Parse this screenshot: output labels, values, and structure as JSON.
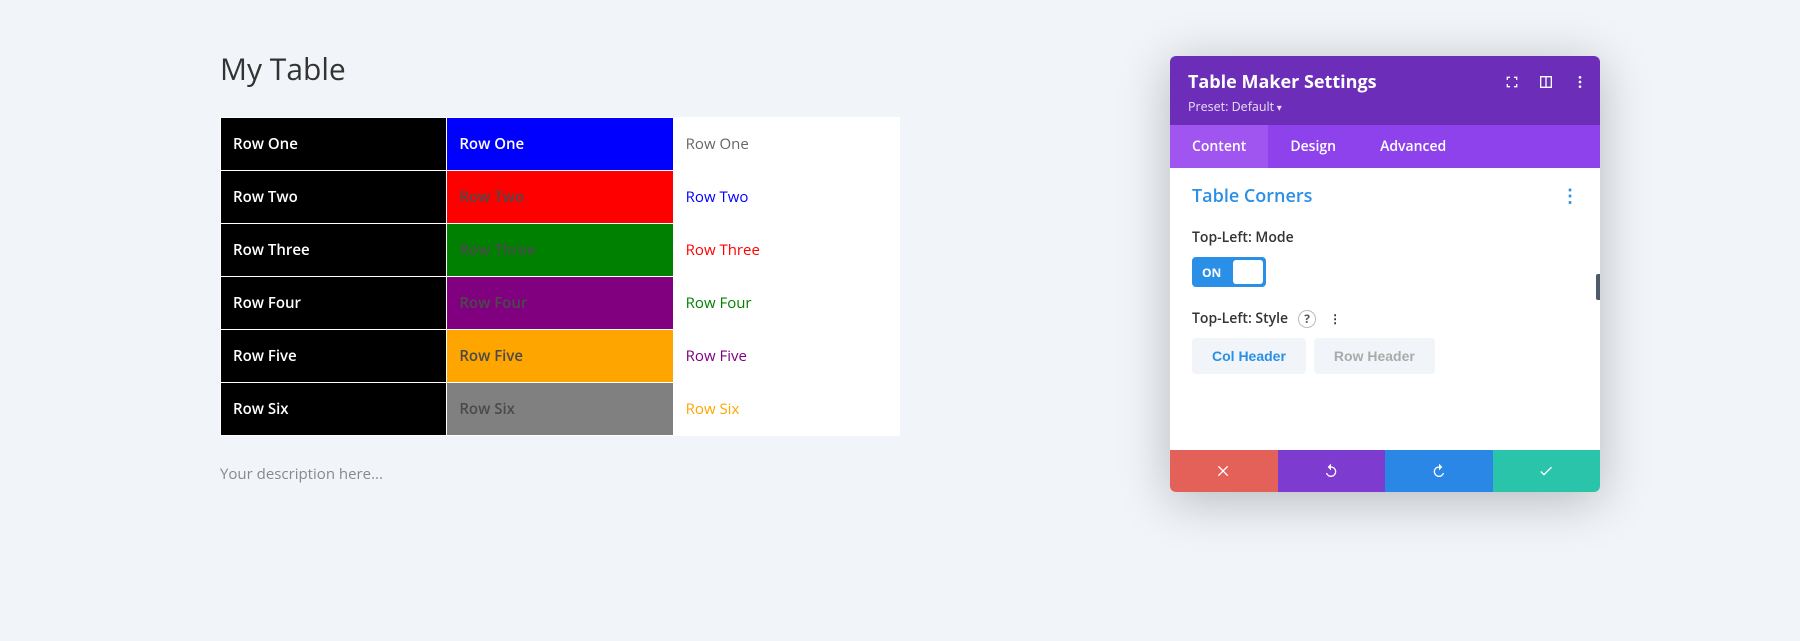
{
  "table": {
    "title": "My Table",
    "description": "Your description here...",
    "rows": [
      {
        "label": "Row One",
        "col2_bg": "#0000ff",
        "col2_fg": "#ffffff",
        "col3_fg": "#666666"
      },
      {
        "label": "Row Two",
        "col2_bg": "#ff0000",
        "col2_fg": "#4a4a4a",
        "col3_fg": "#0000ff"
      },
      {
        "label": "Row Three",
        "col2_bg": "#008000",
        "col2_fg": "#4a4a4a",
        "col3_fg": "#ff0000"
      },
      {
        "label": "Row Four",
        "col2_bg": "#800080",
        "col2_fg": "#4a4a4a",
        "col3_fg": "#008000"
      },
      {
        "label": "Row Five",
        "col2_bg": "#ffa500",
        "col2_fg": "#4a4a4a",
        "col3_fg": "#800080"
      },
      {
        "label": "Row Six",
        "col2_bg": "#808080",
        "col2_fg": "#4a4a4a",
        "col3_fg": "#ffa500"
      }
    ],
    "col3_bg": "#ffffff"
  },
  "panel": {
    "title": "Table Maker Settings",
    "preset": "Preset: Default",
    "tabs": {
      "content": "Content",
      "design": "Design",
      "advanced": "Advanced"
    },
    "section_title": "Table Corners",
    "field_mode_label": "Top-Left: Mode",
    "toggle_on_label": "ON",
    "field_style_label": "Top-Left: Style",
    "style_options": {
      "col_header": "Col Header",
      "row_header": "Row Header"
    },
    "help_symbol": "?"
  }
}
